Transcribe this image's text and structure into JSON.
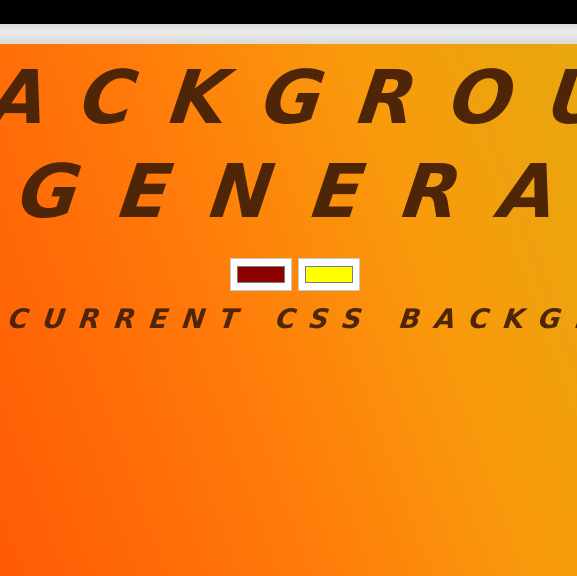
{
  "header": {
    "title_line_1": "ACKGROUND",
    "title_line_2": "GENERATOR"
  },
  "colors": {
    "color_1": "#8b0000",
    "color_2": "#ffff00",
    "gradient_start": "#ff5a05",
    "gradient_end": "#e7a70f",
    "title_color": "#4e2607"
  },
  "main": {
    "subtitle": "CURRENT CSS BACKGROUN"
  }
}
